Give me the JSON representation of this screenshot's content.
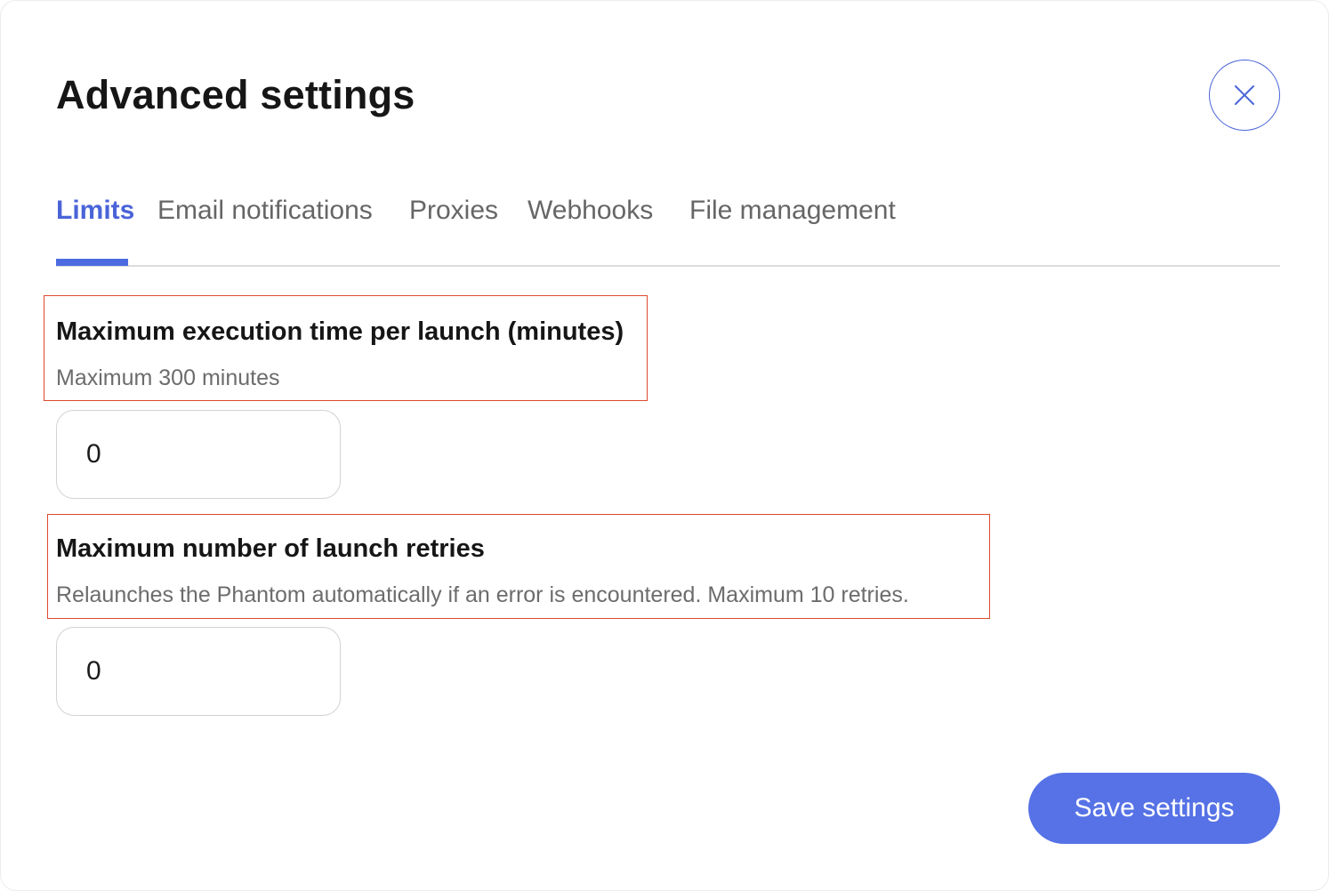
{
  "dialog": {
    "title": "Advanced settings",
    "close_icon": "close-icon"
  },
  "tabs": [
    {
      "label": "Limits",
      "active": true
    },
    {
      "label": "Email notifications",
      "active": false
    },
    {
      "label": "Proxies",
      "active": false
    },
    {
      "label": "Webhooks",
      "active": false
    },
    {
      "label": "File management",
      "active": false
    }
  ],
  "fields": {
    "execution_time": {
      "label": "Maximum execution time per launch (minutes)",
      "help": "Maximum 300 minutes",
      "value": "0"
    },
    "launch_retries": {
      "label": "Maximum number of launch retries",
      "help": "Relaunches the Phantom automatically if an error is encountered. Maximum 10 retries.",
      "value": "0"
    }
  },
  "actions": {
    "save_label": "Save settings"
  },
  "colors": {
    "accent": "#4a64d8",
    "button": "#5672e6",
    "highlight_border": "#dd4a2e"
  }
}
